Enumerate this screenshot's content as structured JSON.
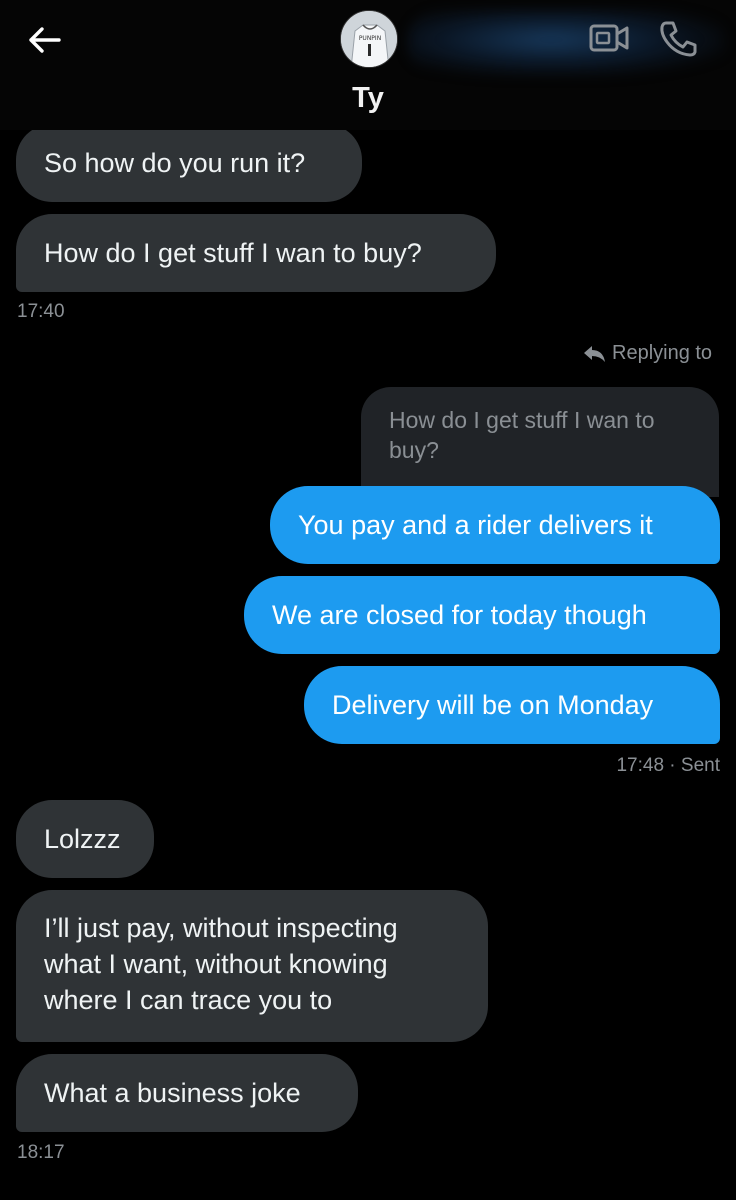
{
  "header": {
    "contact_name": "Ty",
    "avatar_text": "PUNPIN",
    "back_icon": "arrow-left-icon",
    "video_icon": "video-call-icon",
    "phone_icon": "phone-icon"
  },
  "messages": {
    "m1": "So how do you run it?",
    "m2": "How do I get stuff I wan to buy?",
    "t1": "17:40",
    "replying_to": "Replying to",
    "quoted": "How do I get stuff I wan to buy?",
    "m3": "You pay and a rider delivers it",
    "m4": "We are closed for today though",
    "m5": "Delivery will be on Monday",
    "t2": "17:48 · Sent",
    "m6": "Lolzzz",
    "m7": "I’ll just pay, without inspecting what I want, without knowing where I can trace you to",
    "m8": "What a business joke",
    "t3": "18:17"
  },
  "colors": {
    "background": "#000000",
    "incoming_bubble": "#2f3336",
    "outgoing_bubble": "#1d9bf0",
    "muted_text": "#8b9095"
  }
}
